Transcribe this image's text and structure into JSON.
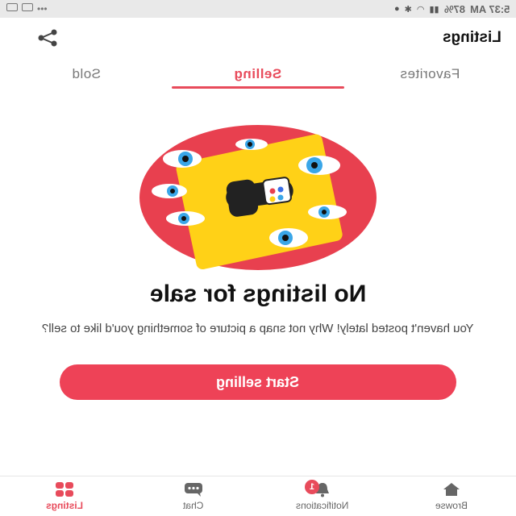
{
  "status_bar": {
    "time": "5:37 AM",
    "battery": "87%"
  },
  "header": {
    "title": "Listings",
    "share_icon": "share-icon"
  },
  "tabs": [
    {
      "label": "Sold",
      "active": false
    },
    {
      "label": "Selling",
      "active": true
    },
    {
      "label": "Favorites",
      "active": false
    }
  ],
  "empty_state": {
    "title": "No listings for sale",
    "description": "You haven't posted lately! Why not snap a picture of something you'd like to sell?",
    "button_label": "Start selling"
  },
  "bottom_nav": [
    {
      "label": "Listings",
      "icon": "grid-icon",
      "active": true
    },
    {
      "label": "Chat",
      "icon": "chat-icon",
      "active": false
    },
    {
      "label": "Notifications",
      "icon": "bell-icon",
      "badge": "1",
      "active": false
    },
    {
      "label": "Browse",
      "icon": "home-icon",
      "active": false
    }
  ],
  "colors": {
    "accent": "#ee4257",
    "illustration_red": "#e8404f",
    "illustration_yellow": "#ffd117",
    "eye_blue": "#3aa6e8"
  }
}
